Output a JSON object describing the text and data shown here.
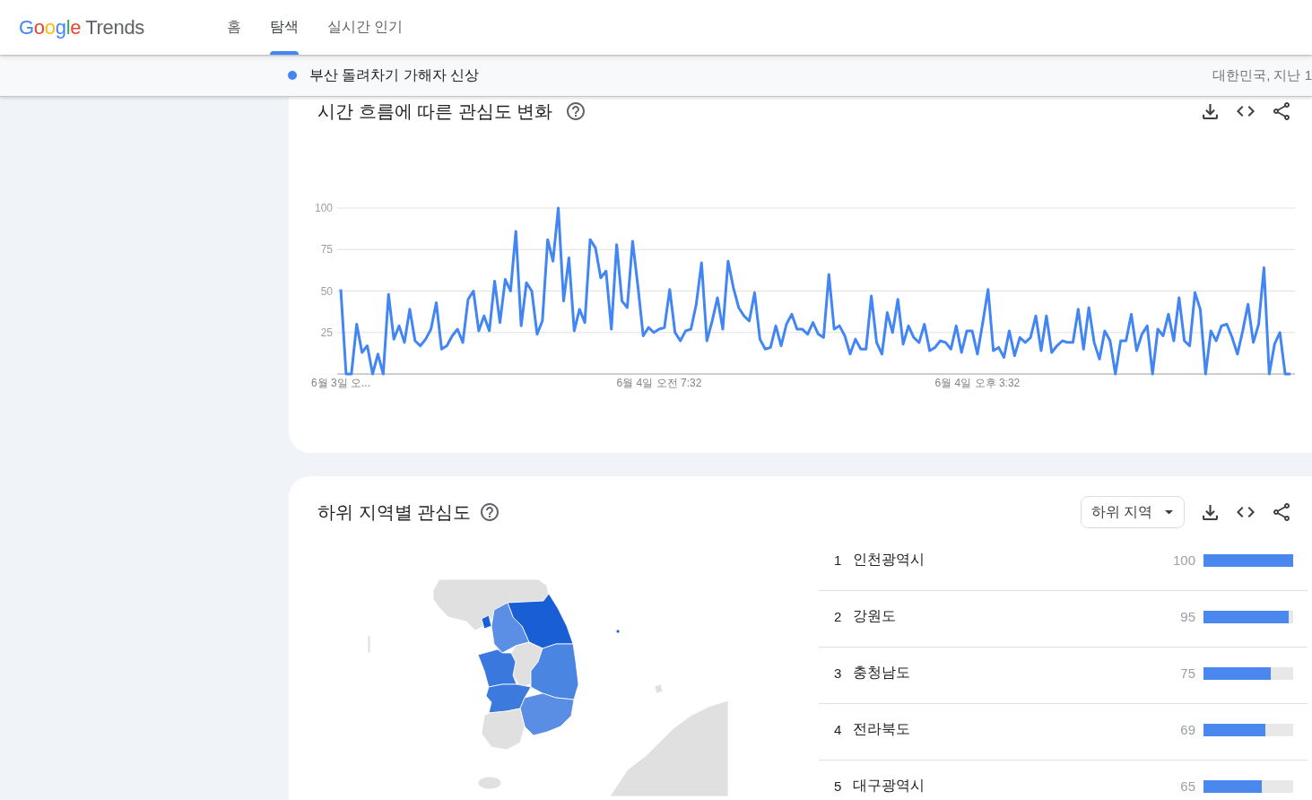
{
  "header": {
    "logo": {
      "brand": "Google",
      "product": "Trends"
    },
    "nav": [
      {
        "label": "홈",
        "selected": false
      },
      {
        "label": "탐색",
        "selected": true
      },
      {
        "label": "실시간 인기",
        "selected": false
      }
    ]
  },
  "search_bar": {
    "terms": [
      {
        "label": "부산 돌려차기 가해자 신상",
        "color": "#4285f4"
      }
    ],
    "filter_summary": "대한민국, 지난 1"
  },
  "interest_over_time": {
    "title": "시간 흐름에 따른 관심도 변화",
    "chart_data": [
      {
        "type": "line",
        "color": "#4285f4",
        "grid": true,
        "ylim": [
          0,
          100
        ],
        "yticks": [
          25,
          50,
          75,
          100
        ],
        "categories": [
          "6월 3일 오...",
          null,
          null,
          null,
          null,
          null,
          null,
          null,
          null,
          null,
          null,
          null,
          null,
          null,
          null,
          null,
          null,
          null,
          null,
          null,
          null,
          null,
          null,
          null,
          null,
          null,
          null,
          null,
          null,
          null,
          null,
          null,
          null,
          null,
          null,
          null,
          null,
          null,
          null,
          null,
          null,
          null,
          null,
          null,
          null,
          null,
          null,
          null,
          null,
          null,
          null,
          null,
          null,
          null,
          null,
          null,
          null,
          null,
          null,
          null,
          "6월 4일 오전 7:32",
          null,
          null,
          null,
          null,
          null,
          null,
          null,
          null,
          null,
          null,
          null,
          null,
          null,
          null,
          null,
          null,
          null,
          null,
          null,
          null,
          null,
          null,
          null,
          null,
          null,
          null,
          null,
          null,
          null,
          null,
          null,
          null,
          null,
          null,
          null,
          null,
          null,
          null,
          null,
          null,
          null,
          null,
          null,
          null,
          null,
          null,
          null,
          null,
          null,
          null,
          null,
          null,
          null,
          null,
          null,
          null,
          null,
          null,
          null,
          "6월 4일 오후 3:32",
          null,
          null,
          null,
          null,
          null,
          null,
          null,
          null,
          null,
          null,
          null,
          null,
          null,
          null,
          null,
          null,
          null,
          null,
          null,
          null,
          null,
          null,
          null,
          null,
          null,
          null,
          null,
          null,
          null,
          null,
          null,
          null,
          null,
          null,
          null,
          null,
          null,
          null,
          null,
          null,
          null,
          null,
          null,
          null,
          null,
          null,
          null,
          null,
          null,
          null,
          null,
          null,
          null,
          null,
          null,
          null,
          null,
          null,
          null
        ],
        "values": [
          51,
          0,
          0,
          30,
          13,
          17,
          0,
          12,
          0,
          48,
          21,
          29,
          19,
          39,
          20,
          17,
          21,
          27,
          43,
          15,
          17,
          23,
          27,
          19,
          45,
          50,
          26,
          35,
          26,
          56,
          31,
          57,
          50,
          86,
          29,
          55,
          50,
          24,
          32,
          81,
          68,
          100,
          44,
          70,
          26,
          39,
          31,
          81,
          76,
          58,
          62,
          27,
          78,
          44,
          40,
          80,
          53,
          23,
          28,
          25,
          27,
          28,
          51,
          25,
          20,
          26,
          27,
          42,
          67,
          20,
          32,
          46,
          27,
          68,
          52,
          40,
          35,
          32,
          49,
          21,
          15,
          16,
          29,
          17,
          30,
          36,
          27,
          27,
          24,
          31,
          24,
          22,
          60,
          27,
          29,
          23,
          12,
          21,
          15,
          15,
          47,
          19,
          12,
          37,
          25,
          45,
          18,
          29,
          22,
          19,
          30,
          14,
          16,
          20,
          19,
          15,
          29,
          13,
          26,
          26,
          12,
          31,
          51,
          14,
          16,
          10,
          26,
          11,
          22,
          19,
          22,
          35,
          14,
          35,
          13,
          17,
          20,
          19,
          19,
          39,
          15,
          40,
          19,
          9,
          26,
          20,
          0,
          20,
          20,
          36,
          14,
          24,
          29,
          0,
          27,
          23,
          36,
          20,
          46,
          20,
          17,
          49,
          39,
          0,
          26,
          20,
          29,
          30,
          22,
          12,
          26,
          42,
          19,
          30,
          64,
          0,
          18,
          25,
          0,
          0
        ]
      }
    ]
  },
  "interest_by_subregion": {
    "title": "하위 지역별 관심도",
    "resolution": "하위 지역",
    "regions": [
      {
        "rank": "1",
        "name": "인천광역시",
        "value": "100",
        "level": 1
      },
      {
        "rank": "2",
        "name": "강원도",
        "value": "95",
        "level": 0.95
      },
      {
        "rank": "3",
        "name": "충청남도",
        "value": "75",
        "level": 0.75
      },
      {
        "rank": "4",
        "name": "전라북도",
        "value": "69",
        "level": 0.69
      },
      {
        "rank": "5",
        "name": "대구광역시",
        "value": "65",
        "level": 0.65
      }
    ]
  }
}
